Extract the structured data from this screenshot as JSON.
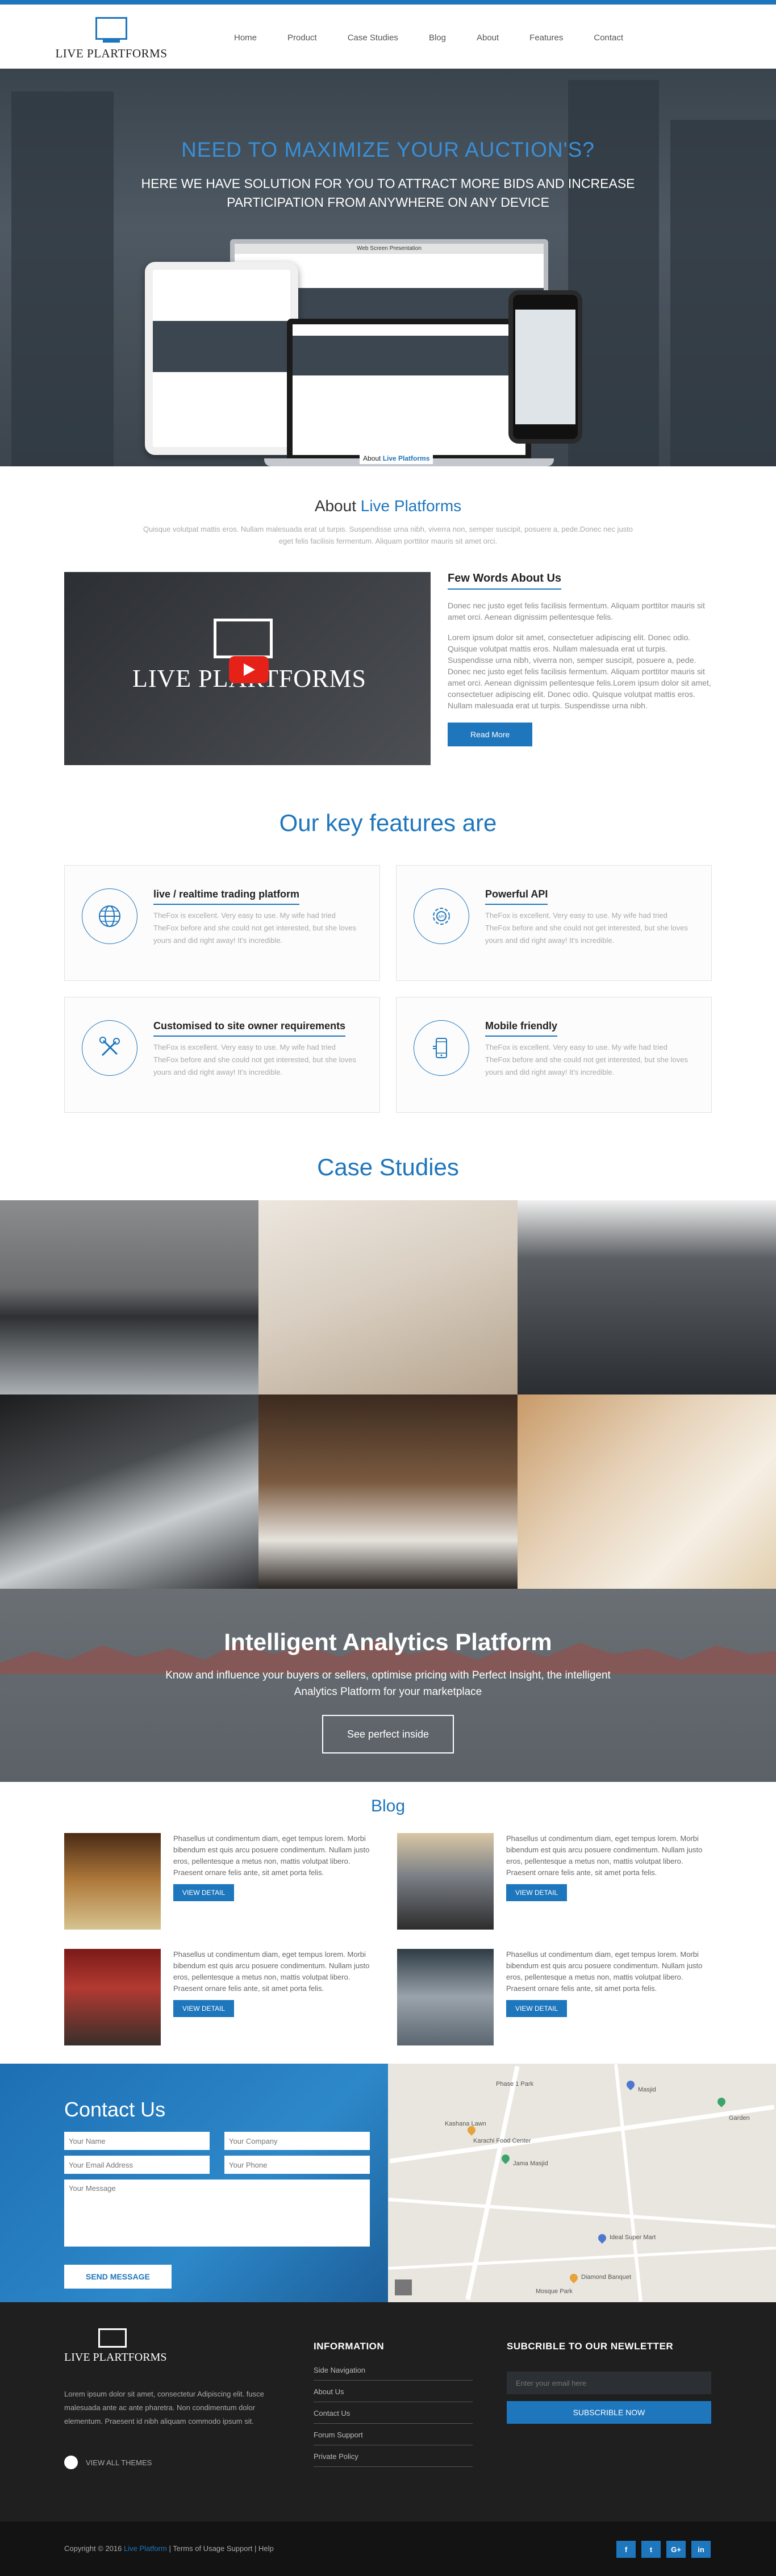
{
  "header": {
    "logo_text": "LIVE PLARTFORMS",
    "nav": [
      "Home",
      "Product",
      "Case Studies",
      "Blog",
      "About",
      "Features",
      "Contact"
    ]
  },
  "hero": {
    "title": "NEED TO MAXIMIZE YOUR AUCTION'S?",
    "subtitle": "HERE WE HAVE SOLUTION FOR YOU TO ATTRACT MORE BIDS AND INCREASE PARTICIPATION FROM ANYWHERE ON ANY DEVICE",
    "caption_prefix": "About ",
    "caption_brand": "Live Platforms",
    "monitor_title": "Web Screen Presentation"
  },
  "about": {
    "title_prefix": "About ",
    "title_brand": "Live Platforms",
    "lead": "Quisque volutpat mattis eros. Nullam malesuada erat ut turpis. Suspendisse urna nibh, viverra non, semper suscipit, posuere a, pede.Donec nec justo eget felis facilisis fermentum. Aliquam porttitor mauris sit amet orci.",
    "video_logo": "LIVE PLARTFORMS",
    "heading": "Few Words About Us",
    "para1": "Donec nec justo eget felis facilisis fermentum. Aliquam porttitor mauris sit amet orci. Aenean dignissim pellentesque felis.",
    "para2": "Lorem ipsum dolor sit amet, consectetuer adipiscing elit. Donec odio. Quisque volutpat mattis eros. Nullam malesuada erat ut turpis. Suspendisse urna nibh, viverra non, semper suscipit, posuere a, pede. Donec nec justo eget felis facilisis fermentum. Aliquam porttitor mauris sit amet orci. Aenean dignissim pellentesque felis.Lorem ipsum dolor sit amet, consectetuer adipiscing elit. Donec odio. Quisque volutpat mattis eros. Nullam malesuada erat ut turpis. Suspendisse urna nibh.",
    "button": "Read More"
  },
  "features": {
    "title": "Our key features are",
    "items": [
      {
        "title": "live / realtime trading platform",
        "text": "TheFox is excellent. Very easy to use. My wife had tried TheFox before and she could not get interested, but she loves yours and did right away! It's incredible.",
        "icon": "globe-icon"
      },
      {
        "title": "Powerful API",
        "text": "TheFox is excellent. Very easy to use. My wife had tried TheFox before and she could not get interested, but she loves yours and did right away! It's incredible.",
        "icon": "api-icon"
      },
      {
        "title": "Customised to site owner requirements",
        "text": "TheFox is excellent. Very easy to use. My wife had tried TheFox before and she could not get interested, but she loves yours and did right away! It's incredible.",
        "icon": "tools-icon"
      },
      {
        "title": "Mobile friendly",
        "text": "TheFox is excellent. Very easy to use. My wife had tried TheFox before and she could not get interested, but she loves yours and did right away! It's incredible.",
        "icon": "mobile-icon"
      }
    ]
  },
  "cases": {
    "title": "Case Studies"
  },
  "analytics": {
    "title": "Intelligent Analytics Platform",
    "text": "Know and influence your buyers or sellers, optimise pricing with Perfect Insight, the intelligent Analytics Platform for your marketplace",
    "button": "See perfect inside"
  },
  "blog": {
    "title": "Blog",
    "posts": [
      {
        "text": "Phasellus ut condimentum diam, eget tempus lorem. Morbi bibendum est quis arcu posuere condimentum. Nullam justo eros, pellentesque a metus non, mattis volutpat libero. Praesent ornare felis ante, sit amet porta felis.",
        "button": "VIEW DETAIL"
      },
      {
        "text": "Phasellus ut condimentum diam, eget tempus lorem. Morbi bibendum est quis arcu posuere condimentum. Nullam justo eros, pellentesque a metus non, mattis volutpat libero. Praesent ornare felis ante, sit amet porta felis.",
        "button": "VIEW DETAIL"
      },
      {
        "text": "Phasellus ut condimentum diam, eget tempus lorem. Morbi bibendum est quis arcu posuere condimentum. Nullam justo eros, pellentesque a metus non, mattis volutpat libero. Praesent ornare felis ante, sit amet porta felis.",
        "button": "VIEW DETAIL"
      },
      {
        "text": "Phasellus ut condimentum diam, eget tempus lorem. Morbi bibendum est quis arcu posuere condimentum. Nullam justo eros, pellentesque a metus non, mattis volutpat libero. Praesent ornare felis ante, sit amet porta felis.",
        "button": "VIEW DETAIL"
      }
    ]
  },
  "contact": {
    "title": "Contact Us",
    "name_placeholder": "Your Name",
    "company_placeholder": "Your Company",
    "email_placeholder": "Your Email Address",
    "phone_placeholder": "Your Phone",
    "message_placeholder": "Your Message",
    "button": "SEND MESSAGE"
  },
  "map": {
    "labels": [
      "Phase 1 Park",
      "Karachi Food Center",
      "Jama Masjid",
      "Ideal Super Mart",
      "Masjid",
      "Diamond Banquet",
      "Mosque Park",
      "Garden",
      "Kashana Lawn"
    ]
  },
  "footer": {
    "logo_text": "LIVE PLARTFORMS",
    "about": "Lorem ipsum dolor sit amet, consectetur Adipiscing elit. fusce malesuada ante ac ante pharetra. Non condimentum dolor elementum. Praesent id nibh aliquam commodo ipsum sit.",
    "view_themes": "VIEW ALL THEMES",
    "info_title": "INFORMATION",
    "info_links": [
      "Side Navigation",
      "About Us",
      "Contact Us",
      "Forum Support",
      "Private Policy"
    ],
    "news_title": "SUBCRIBLE TO OUR NEWLETTER",
    "news_placeholder": "Enter your email here",
    "news_button": "SUBSCRIBLE NOW",
    "copy_prefix": "Copyright © 2016 ",
    "copy_brand": "Live Platform",
    "copy_suffix": " | Terms of Usage Support | Help",
    "socials": [
      "f",
      "t",
      "G+",
      "in"
    ]
  },
  "colors": {
    "accent": "#1e76bd",
    "footer": "#1f1f1f"
  }
}
